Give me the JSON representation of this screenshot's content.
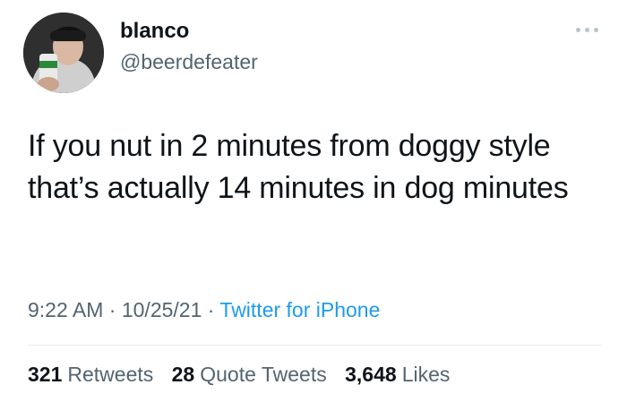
{
  "user": {
    "display_name": "blanco",
    "handle": "@beerdefeater",
    "avatar_icon": "profile-photo-avatar"
  },
  "tweet": {
    "text": "If you nut in 2 minutes from doggy style that’s actually 14 minutes in dog minutes",
    "time": "9:22 AM",
    "date": "10/25/21",
    "separator": "·",
    "source": "Twitter for iPhone"
  },
  "stats": {
    "retweets": {
      "count": "321",
      "label": "Retweets"
    },
    "quotes": {
      "count": "28",
      "label": "Quote Tweets"
    },
    "likes": {
      "count": "3,648",
      "label": "Likes"
    }
  },
  "colors": {
    "text": "#0f1419",
    "secondary": "#536471",
    "link": "#1d9bf0"
  }
}
